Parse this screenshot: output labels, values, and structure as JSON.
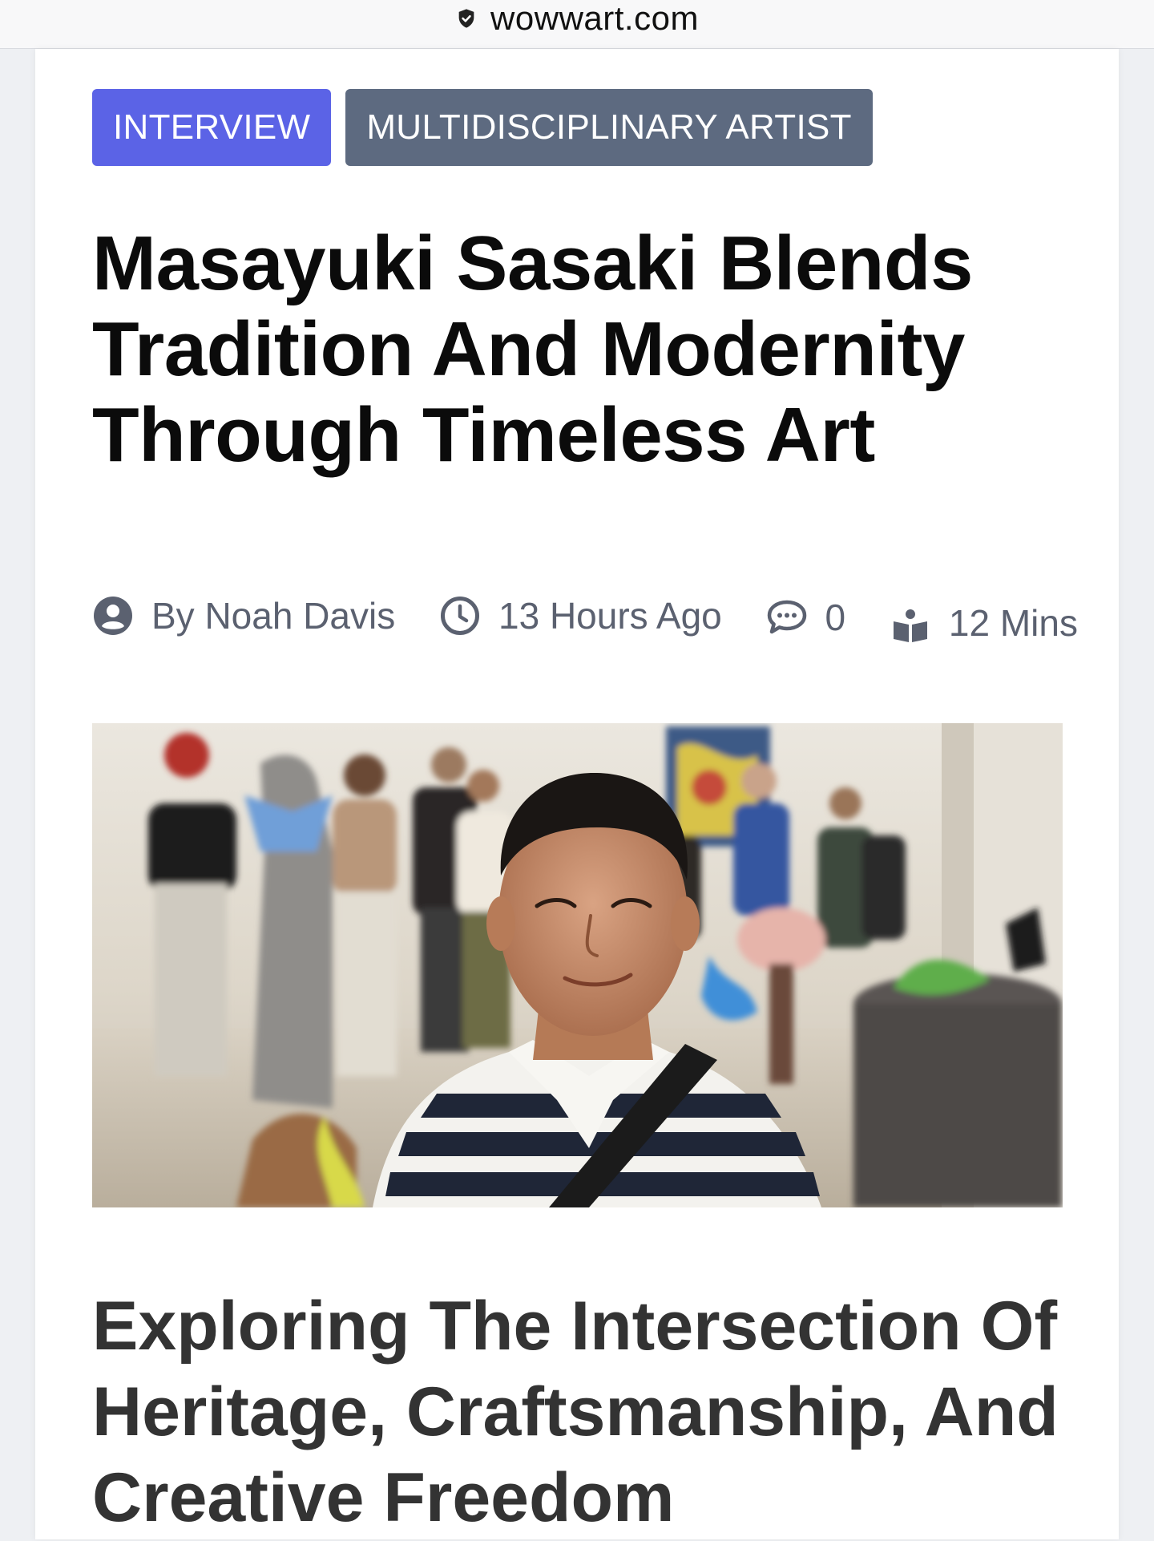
{
  "browser": {
    "url": "wowwart.com"
  },
  "article": {
    "tags": [
      "INTERVIEW",
      "MULTIDISCIPLINARY ARTIST"
    ],
    "headline": "Masayuki Sasaki Blends Tradition And Modernity Through Timeless Art",
    "meta": {
      "author": "By Noah Davis",
      "published": "13 Hours Ago",
      "comments": "0",
      "read_time": "12 Mins"
    },
    "subheading": "Exploring The Intersection Of Heritage, Craftsmanship, And Creative Freedom"
  },
  "icons": {
    "lock": "shield-lock-icon",
    "author": "user-circle-icon",
    "time": "clock-icon",
    "comments": "comment-bubble-icon",
    "read_time": "reading-icon"
  },
  "colors": {
    "tag_primary": "#5b63e6",
    "tag_secondary": "#5d6a80",
    "headline": "#0b0b0b",
    "meta": "#5b6170",
    "subheading": "#333333"
  }
}
